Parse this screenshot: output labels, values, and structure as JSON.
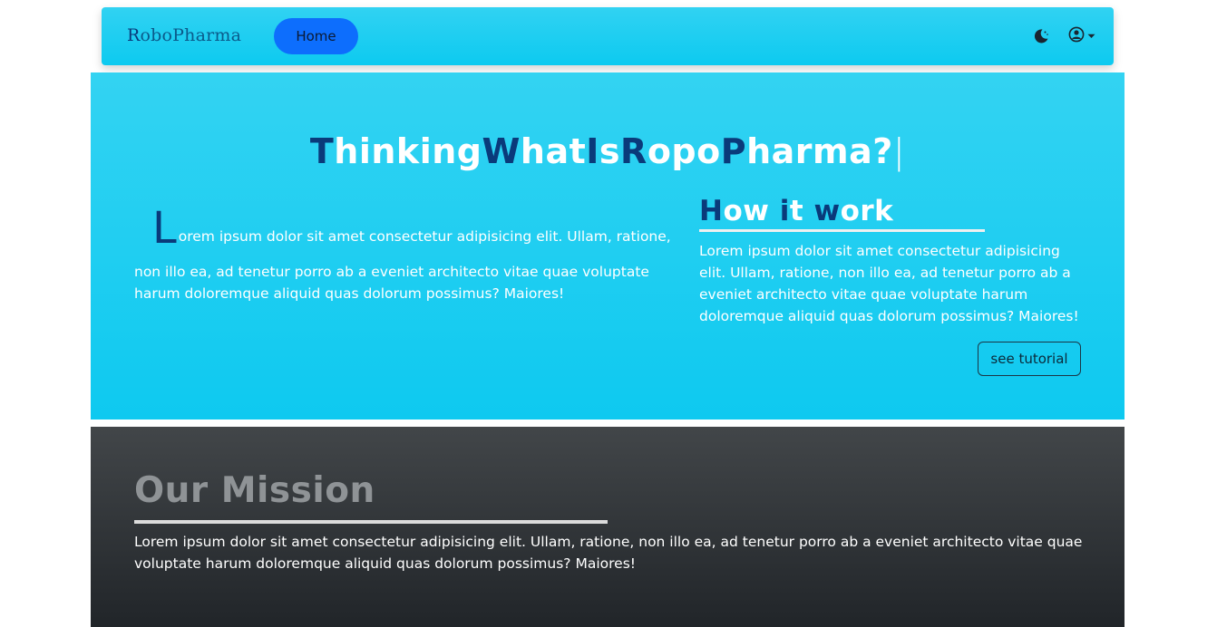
{
  "navbar": {
    "brand": {
      "first_letter": "R",
      "rest": "oboPharma"
    },
    "home_label": "Home",
    "icons": {
      "theme": "moon-icon",
      "user": "user-circle-icon",
      "dropdown": "caret-down-icon"
    }
  },
  "hero": {
    "title_segments": [
      {
        "text": "T",
        "cap": true
      },
      {
        "text": "hinking",
        "cap": false
      },
      {
        "text": "W",
        "cap": true
      },
      {
        "text": "hat",
        "cap": false
      },
      {
        "text": "I",
        "cap": true
      },
      {
        "text": "s",
        "cap": false
      },
      {
        "text": "R",
        "cap": true
      },
      {
        "text": "opo",
        "cap": false
      },
      {
        "text": "P",
        "cap": true
      },
      {
        "text": "harma?",
        "cap": false
      }
    ],
    "title_cursor": "|",
    "intro": {
      "dropcap": "L",
      "first_line": "orem ipsum dolor sit amet consectetur adipisicing elit. Ullam, ratione,",
      "rest": "non illo ea, ad tenetur porro ab a eveniet architecto vitae quae voluptate harum doloremque aliquid quas dolorum possimus? Maiores!"
    },
    "how_it_works": {
      "title_segments": [
        {
          "text": "H",
          "cap": true
        },
        {
          "text": "ow ",
          "cap": false
        },
        {
          "text": "i",
          "cap": true
        },
        {
          "text": "t ",
          "cap": false
        },
        {
          "text": "w",
          "cap": true
        },
        {
          "text": "ork",
          "cap": false
        }
      ],
      "text": "Lorem ipsum dolor sit amet consectetur adipisicing elit. Ullam, ratione, non illo ea, ad tenetur porro ab a eveniet architecto vitae quae voluptate harum doloremque aliquid quas dolorum possimus? Maiores!",
      "button_label": "see tutorial"
    }
  },
  "mission": {
    "title": "Our Mission",
    "text": "Lorem ipsum dolor sit amet consectetur adipisicing elit. Ullam, ratione, non illo ea, ad tenetur porro ab a eveniet architecto vitae quae voluptate harum doloremque aliquid quas dolorum possimus? Maiores!"
  },
  "colors": {
    "accent_cyan": "#0dcaf0",
    "capital_navy": "#0a3a7a",
    "primary_blue": "#0d6efd",
    "dark_section": "#212529"
  }
}
